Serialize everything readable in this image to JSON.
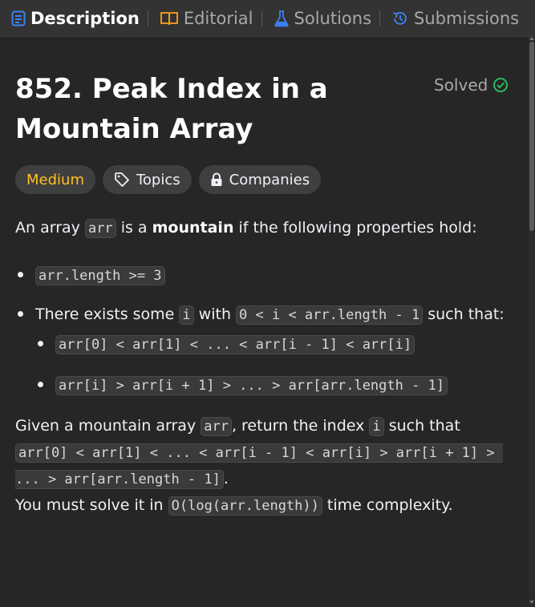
{
  "tabs": [
    {
      "label": "Description",
      "active": true,
      "icon": "description-icon"
    },
    {
      "label": "Editorial",
      "active": false,
      "icon": "book-icon"
    },
    {
      "label": "Solutions",
      "active": false,
      "icon": "flask-icon"
    },
    {
      "label": "Submissions",
      "active": false,
      "icon": "history-icon"
    }
  ],
  "problem": {
    "title": "852. Peak Index in a Mountain Array",
    "status": "Solved",
    "difficulty": "Medium",
    "topics_label": "Topics",
    "companies_label": "Companies"
  },
  "description": {
    "intro_1": "An array ",
    "intro_code": "arr",
    "intro_2": " is a ",
    "intro_bold": "mountain",
    "intro_3": " if the following properties hold:",
    "bullet1_code": "arr.length >= 3",
    "bullet2_t1": "There exists some ",
    "bullet2_code1": "i",
    "bullet2_t2": " with ",
    "bullet2_code2": "0 < i < arr.length - 1",
    "bullet2_t3": " such that:",
    "sub1_code": "arr[0] < arr[1] < ... < arr[i - 1] < arr[i]",
    "sub2_code": "arr[i] > arr[i + 1] > ... > arr[arr.length - 1]",
    "p2_t1": "Given a mountain array ",
    "p2_code1": "arr",
    "p2_t2": ", return the index ",
    "p2_code2": "i",
    "p2_t3": " such that ",
    "p2_code3": "arr[0] < arr[1] < ... < arr[i - 1] < arr[i] > arr[i + 1] > ... > arr[arr.length - 1]",
    "p2_t4": ".",
    "p3_t1": "You must solve it in ",
    "p3_code": "O(log(arr.length))",
    "p3_t2": " time complexity."
  },
  "colors": {
    "accent_blue": "#3b82f6",
    "solved_green": "#2cbb5d",
    "medium_yellow": "#ffc01e",
    "background": "#262626",
    "tabbar": "#333333"
  }
}
